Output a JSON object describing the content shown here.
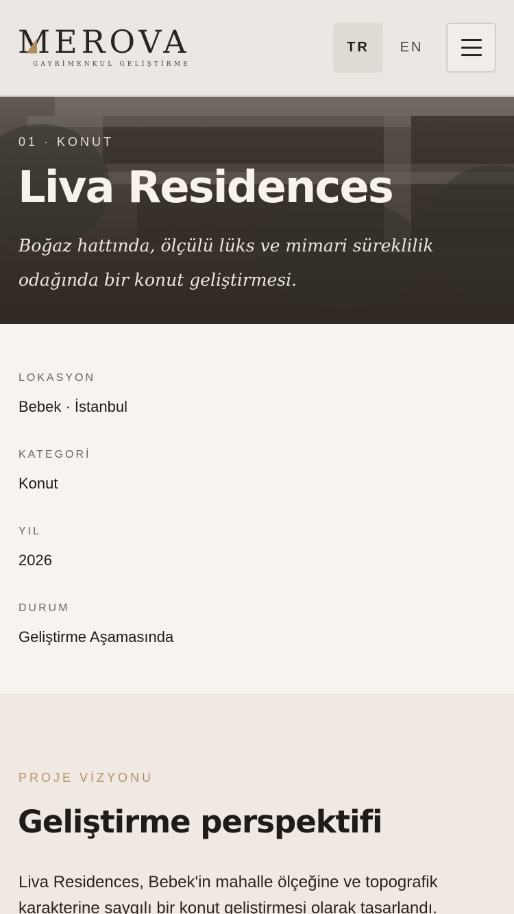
{
  "header": {
    "brand_name": "MEROVA",
    "brand_tagline": "GAYRİMENKUL GELİŞTİRME",
    "lang_tr": "TR",
    "lang_en": "EN",
    "active_lang": "TR",
    "menu_icon": "hamburger-menu-icon"
  },
  "hero": {
    "kicker": "01 · KONUT",
    "title": "Liva Residences",
    "subtitle": "Boğaz hattında, ölçülü lüks ve mimari süreklilik odağında bir konut geliştirmesi."
  },
  "info": {
    "location_label": "LOKASYON",
    "location_value": "Bebek · İstanbul",
    "category_label": "KATEGORİ",
    "category_value": "Konut",
    "year_label": "YIL",
    "year_value": "2026",
    "status_label": "DURUM",
    "status_value": "Geliştirme Aşamasında"
  },
  "vision": {
    "kicker": "PROJE VİZYONU",
    "title": "Geliştirme perspektifi",
    "body": "Liva Residences, Bebek'in mahalle ölçeğine ve topografik karakterine saygılı bir konut geliştirmesi olarak tasarlandı."
  },
  "colors": {
    "accent_gold": "#b39464",
    "background": "#f7f4ef",
    "text_dark": "#1f1b18"
  }
}
